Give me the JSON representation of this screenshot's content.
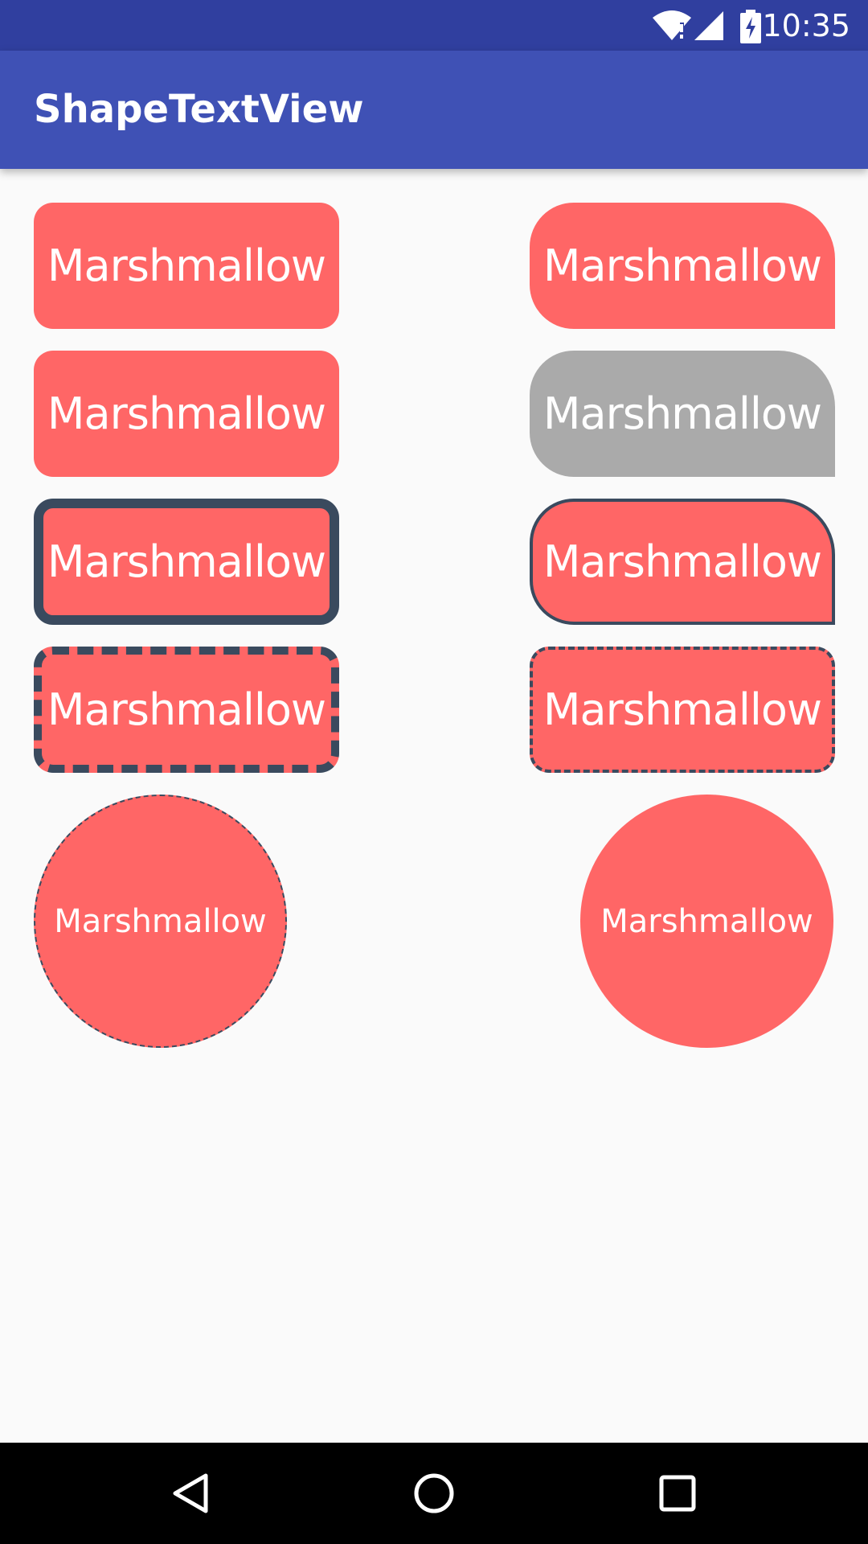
{
  "status_bar": {
    "time": "10:35",
    "icons": [
      "wifi-icon",
      "signal-icon",
      "battery-charging-icon"
    ]
  },
  "app_bar": {
    "title": "ShapeTextView"
  },
  "shapes": [
    {
      "label": "Marshmallow",
      "fill": "#ff6666",
      "style": "rounded"
    },
    {
      "label": "Marshmallow",
      "fill": "#ff6666",
      "style": "rounded-corner"
    },
    {
      "label": "Marshmallow",
      "fill": "#ff6666",
      "style": "rounded"
    },
    {
      "label": "Marshmallow",
      "fill": "#aaaaaa",
      "style": "rounded-corner"
    },
    {
      "label": "Marshmallow",
      "fill": "#ff6666",
      "style": "rounded-solid-border"
    },
    {
      "label": "Marshmallow",
      "fill": "#ff6666",
      "style": "rounded-corner-solid-border"
    },
    {
      "label": "Marshmallow",
      "fill": "#ff6666",
      "style": "rounded-dashed-border"
    },
    {
      "label": "Marshmallow",
      "fill": "#ff6666",
      "style": "rounded-dashed-border-thin"
    },
    {
      "label": "Marshmallow",
      "fill": "#ff6666",
      "style": "circle-dashed-border"
    },
    {
      "label": "Marshmallow",
      "fill": "#ff6666",
      "style": "circle"
    }
  ],
  "colors": {
    "status_bar": "#303f9f",
    "app_bar": "#3f51b5",
    "shape_red": "#ff6666",
    "shape_gray": "#aaaaaa",
    "border": "#3a4a5e",
    "background": "#fafafa"
  },
  "nav_bar": {
    "buttons": [
      "back-icon",
      "home-icon",
      "recents-icon"
    ]
  }
}
